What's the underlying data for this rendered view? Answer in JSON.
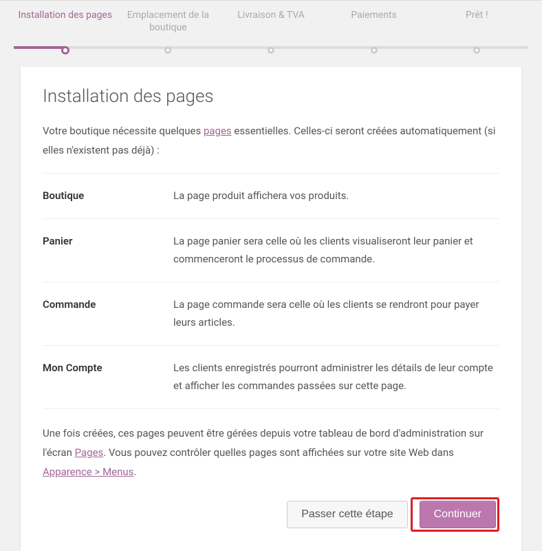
{
  "stepper": {
    "steps": [
      {
        "label": "Installation des pages",
        "active": true
      },
      {
        "label": "Emplacement de la boutique",
        "active": false
      },
      {
        "label": "Livraison & TVA",
        "active": false
      },
      {
        "label": "Paiements",
        "active": false
      },
      {
        "label": "Prêt !",
        "active": false
      }
    ],
    "progress_pct": 10
  },
  "card": {
    "title": "Installation des pages",
    "intro_pre": "Votre boutique nécessite quelques ",
    "intro_link": "pages",
    "intro_post": " essentielles. Celles-ci seront créées automatiquement (si elles n'existent pas déjà) :",
    "rows": [
      {
        "name": "Boutique",
        "desc": "La page produit affichera vos produits."
      },
      {
        "name": "Panier",
        "desc": "La page panier sera celle où les clients visualiseront leur panier et commenceront le processus de commande."
      },
      {
        "name": "Commande",
        "desc": "La page commande sera celle où les clients se rendront pour payer leurs articles."
      },
      {
        "name": "Mon Compte",
        "desc": "Les clients enregistrés pourront administrer les détails de leur compte et afficher les commandes passées sur cette page."
      }
    ],
    "outro_1": "Une fois créées, ces pages peuvent être gérées depuis votre tableau de bord d'administration sur l'écran ",
    "outro_link1": "Pages",
    "outro_2": ". Vous pouvez contrôler quelles pages sont affichées sur votre site Web dans ",
    "outro_link2": "Apparence > Menus",
    "outro_3": ".",
    "skip_label": "Passer cette étape",
    "continue_label": "Continuer"
  }
}
